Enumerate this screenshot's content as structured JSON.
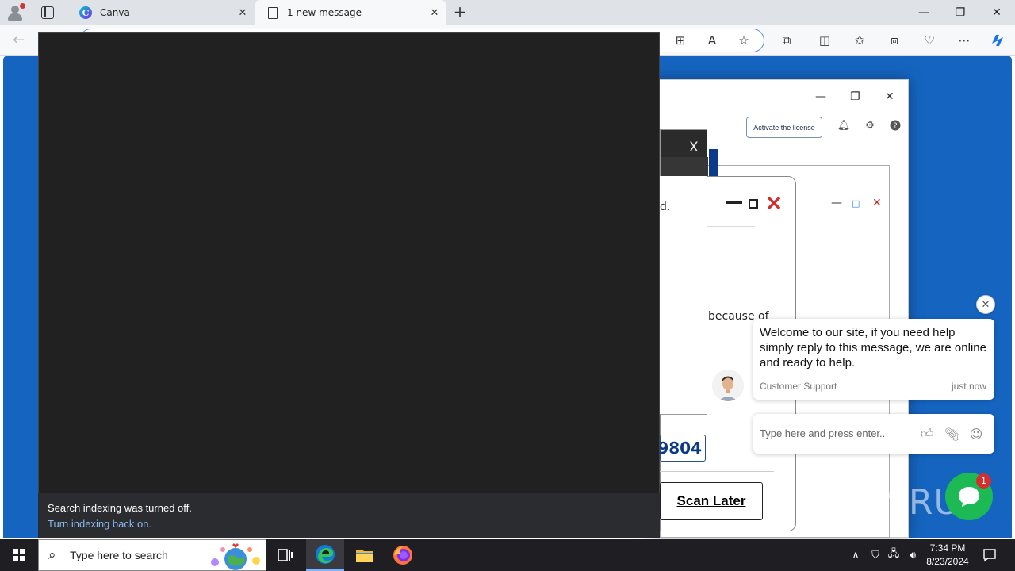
{
  "browser": {
    "tabs": [
      {
        "title": "Canva",
        "active": false
      },
      {
        "title": "1 new message",
        "active": true
      }
    ],
    "new_tab_label": "+",
    "window_controls": {
      "minimize": "—",
      "restore": "❐",
      "close": "✕"
    }
  },
  "antivirus_window": {
    "license_button": "Activate the license",
    "scan_later_button": "Scan Later",
    "code_fragment": "9804",
    "text_fragment_1": "d.",
    "text_fragment_2": "because of"
  },
  "dark_dialog": {
    "close_label": "X"
  },
  "toast": {
    "message": "Search indexing was turned off.",
    "link": "Turn indexing back on."
  },
  "chat": {
    "message": "Welcome to our site, if you need help simply reply to this message, we are online and ready to help.",
    "sender": "Customer Support",
    "time": "just now",
    "input_placeholder": "Type here and press enter..",
    "badge_count": "1"
  },
  "watermark": "ANY RUN",
  "taskbar": {
    "search_placeholder": "Type here to search",
    "time": "7:34 PM",
    "date": "8/23/2024"
  },
  "colors": {
    "page_background": "#1565c0",
    "chat_launcher": "#1db954",
    "badge": "#d32f2f",
    "toast_link": "#8ab8f2",
    "code_text": "#0a3a86"
  }
}
